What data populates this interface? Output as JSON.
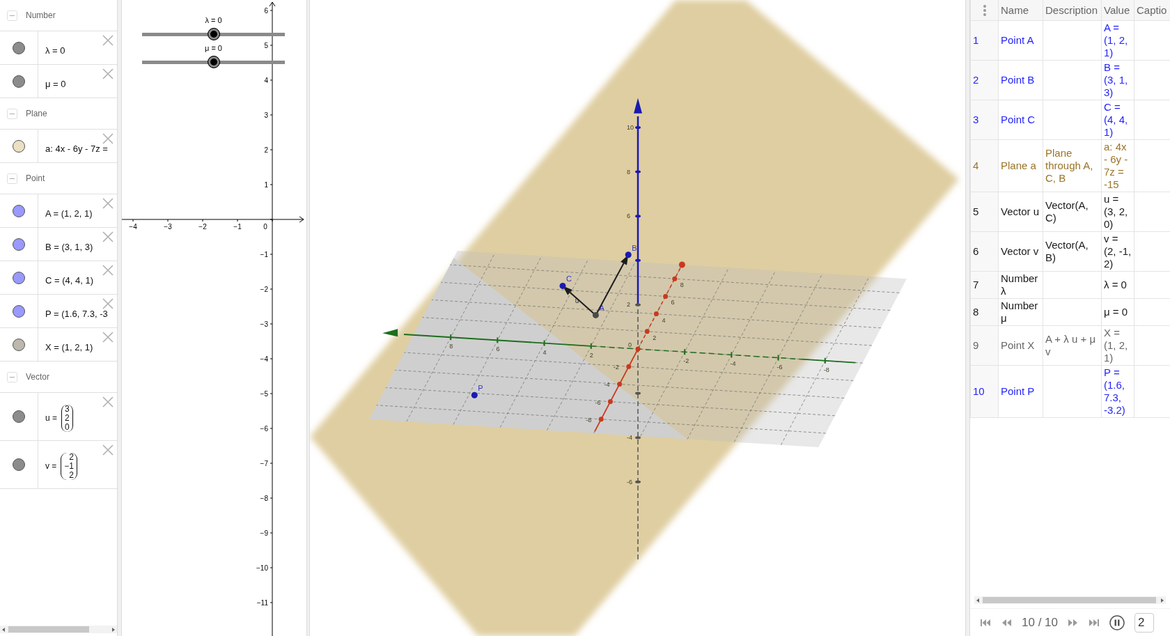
{
  "algebra": {
    "groups": [
      {
        "title": "Number",
        "expanded": true,
        "items": [
          {
            "kind": "text",
            "text": "λ = 0",
            "color": "#8c8c8c",
            "visible": true
          },
          {
            "kind": "text",
            "text": "μ = 0",
            "color": "#8c8c8c",
            "visible": true
          }
        ]
      },
      {
        "title": "Plane",
        "expanded": true,
        "items": [
          {
            "kind": "text",
            "text": "a: 4x - 6y - 7z =",
            "color": "#ebe0c4",
            "visible": true
          }
        ]
      },
      {
        "title": "Point",
        "expanded": true,
        "items": [
          {
            "kind": "text",
            "text": "A = (1, 2, 1)",
            "color": "#9999ff",
            "visible": true
          },
          {
            "kind": "text",
            "text": "B = (3, 1, 3)",
            "color": "#9999ff",
            "visible": true
          },
          {
            "kind": "text",
            "text": "C = (4, 4, 1)",
            "color": "#9999ff",
            "visible": true
          },
          {
            "kind": "text",
            "text": "P = (1.6, 7.3, -3",
            "color": "#9999ff",
            "visible": true
          },
          {
            "kind": "text",
            "text": "X = (1, 2, 1)",
            "color": "#bcb8ae",
            "visible": true
          }
        ]
      },
      {
        "title": "Vector",
        "expanded": true,
        "items": [
          {
            "kind": "vector",
            "name": "u =",
            "components": [
              "3",
              "2",
              "0"
            ],
            "color": "#8c8c8c",
            "visible": true
          },
          {
            "kind": "vector",
            "name": "v =",
            "components": [
              "2",
              "−1",
              "2"
            ],
            "color": "#8c8c8c",
            "visible": true
          }
        ]
      }
    ]
  },
  "graphics2d": {
    "sliders": [
      {
        "label": "λ = 0",
        "level": 0.5
      },
      {
        "label": "μ = 0",
        "level": 0.5
      }
    ],
    "x_ticks": [
      "−4",
      "−3",
      "−2",
      "−1"
    ],
    "origin": "0",
    "y_ticks": [
      "6",
      "5",
      "4",
      "3",
      "2",
      "1",
      "−1",
      "−2",
      "−3",
      "−4",
      "−5",
      "−6",
      "−7",
      "−8",
      "−9",
      "−10",
      "−11"
    ]
  },
  "view3d": {
    "x_ticks": [
      "8",
      "6",
      "4",
      "2",
      "-2",
      "-4",
      "-6",
      "-8"
    ],
    "y_ticks": [
      "8",
      "6",
      "4",
      "2",
      "-2",
      "-4",
      "-6",
      "-8"
    ],
    "z_ticks": [
      "10",
      "8",
      "6",
      "2",
      "-4",
      "-6"
    ],
    "origin": "0",
    "point_labels": [
      "A",
      "B",
      "C",
      "P"
    ],
    "vector_labels": [
      "u"
    ]
  },
  "protocol": {
    "columns": [
      "Name",
      "Description",
      "Value",
      "Captio"
    ],
    "rows": [
      {
        "number": "1",
        "name": "Point A",
        "value": "A = (1, 2, 1)",
        "color": "#1f1fff"
      },
      {
        "number": "2",
        "name": "Point B",
        "value": "B = (3, 1, 3)",
        "color": "#1f1fff"
      },
      {
        "number": "3",
        "name": "Point C",
        "value": "C = (4, 4, 1)",
        "color": "#1f1fff"
      },
      {
        "number": "4",
        "name": "Plane a",
        "description": "Plane through A, C, B",
        "value": "a: 4x - 6y - 7z = -15",
        "color": "#9a7428"
      },
      {
        "number": "5",
        "name": "Vector u",
        "description": "Vector(A, C)",
        "value": "u = (3, 2, 0)",
        "color": "#1a1a1a"
      },
      {
        "number": "6",
        "name": "Vector v",
        "description": "Vector(A, B)",
        "value": "v = (2, -1, 2)",
        "color": "#1a1a1a"
      },
      {
        "number": "7",
        "name": "Number λ",
        "value": "λ = 0",
        "color": "#1a1a1a"
      },
      {
        "number": "8",
        "name": "Number μ",
        "value": "μ = 0",
        "color": "#1a1a1a"
      },
      {
        "number": "9",
        "name": "Point X",
        "description": "A + λ u + μ v",
        "value": "X = (1, 2, 1)",
        "color": "#666666"
      },
      {
        "number": "10",
        "name": "Point P",
        "value": "P = (1.6, 7.3, -3.2)",
        "color": "#1f1fff"
      }
    ]
  },
  "navigation": {
    "position": "10 / 10",
    "playing": true,
    "speed": "2"
  }
}
